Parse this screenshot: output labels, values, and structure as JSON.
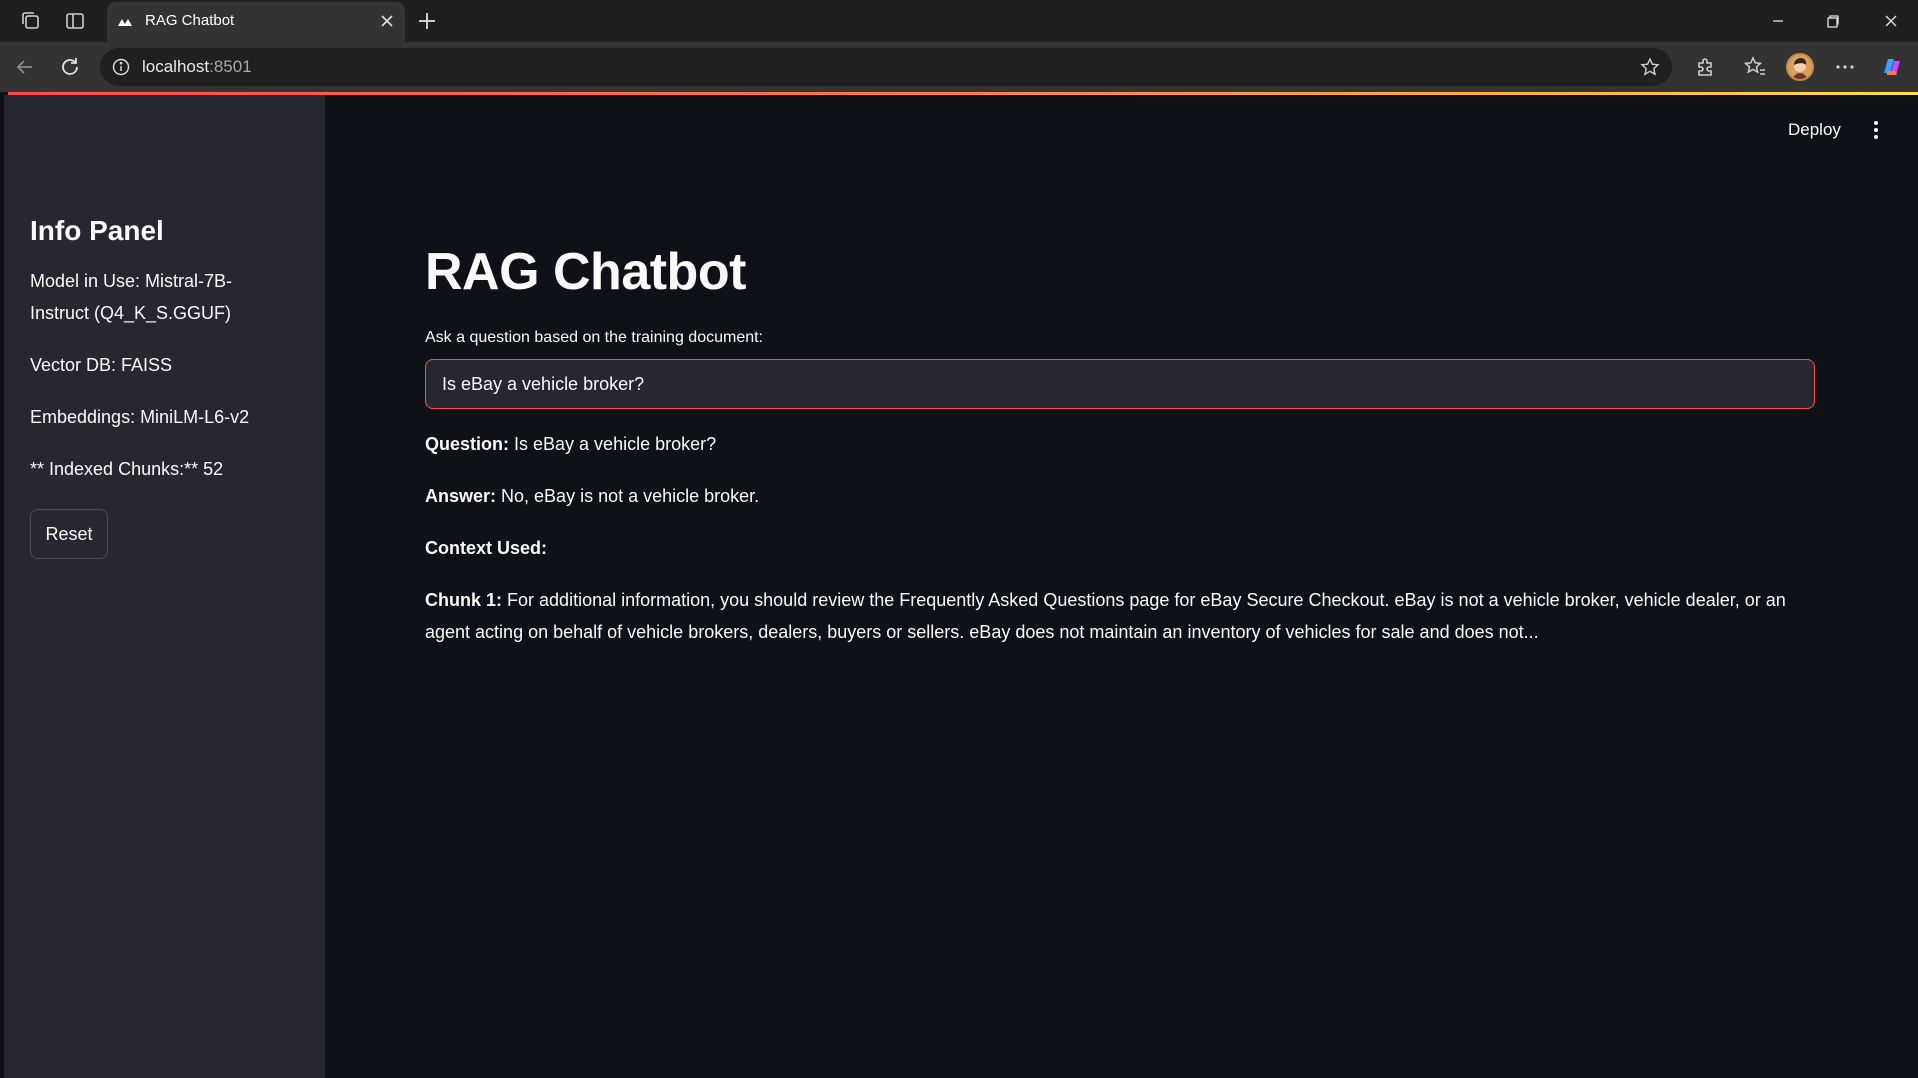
{
  "browser": {
    "tab_title": "RAG Chatbot",
    "url_host": "localhost",
    "url_port": ":8501"
  },
  "sidebar": {
    "title": "Info Panel",
    "model_line": "Model in Use: Mistral-7B-Instruct (Q4_K_S.GGUF)",
    "vector_db_line": "Vector DB: FAISS",
    "embeddings_line": "Embeddings: MiniLM-L6-v2",
    "chunks_line": "** Indexed Chunks:** 52",
    "reset_label": "Reset"
  },
  "header": {
    "deploy_label": "Deploy"
  },
  "main": {
    "title": "RAG Chatbot",
    "input_label": "Ask a question based on the training document:",
    "input_value": "Is eBay a vehicle broker?",
    "question_label": "Question:",
    "question_text": "Is eBay a vehicle broker?",
    "answer_label": "Answer:",
    "answer_text": "No, eBay is not a vehicle broker.",
    "context_label": "Context Used:",
    "chunk_label": "Chunk 1:",
    "chunk_text": "For additional information, you should review the Frequently Asked Questions page for eBay Secure Checkout. eBay is not a vehicle broker, vehicle dealer, or an agent acting on behalf of vehicle brokers, dealers, buyers or sellers. eBay does not maintain an inventory of vehicles for sale and does not..."
  },
  "colors": {
    "accent": "#ff4b4b",
    "sidebar_bg": "#262730",
    "main_bg": "#0e1117"
  }
}
